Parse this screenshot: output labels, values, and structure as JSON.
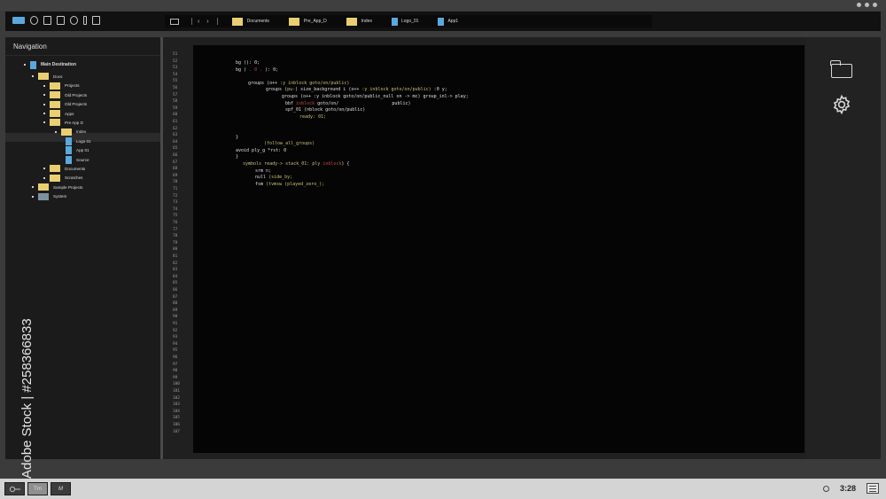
{
  "breadcrumbs": [
    {
      "label": "Documents",
      "kind": "folder"
    },
    {
      "label": "Pre_App_D",
      "kind": "folder"
    },
    {
      "label": "Index",
      "kind": "folder"
    },
    {
      "label": "Logo_01",
      "kind": "file"
    },
    {
      "label": "App1",
      "kind": "file"
    }
  ],
  "nav": {
    "title": "Navigation",
    "tree": [
      {
        "label": "Main Destination",
        "kind": "file",
        "level": 0,
        "bold": true
      },
      {
        "label": "Docs",
        "kind": "folder",
        "level": 1
      },
      {
        "label": "Projects",
        "kind": "folder",
        "level": 2
      },
      {
        "label": "Old Projects",
        "kind": "folder",
        "level": 2
      },
      {
        "label": "Old Projects",
        "kind": "folder",
        "level": 2
      },
      {
        "label": "Apps",
        "kind": "folder",
        "level": 2
      },
      {
        "label": "Pre App D",
        "kind": "folder",
        "level": 2
      },
      {
        "label": "Index",
        "kind": "folder",
        "level": 3,
        "selected": true
      },
      {
        "label": "Logo 01",
        "kind": "file",
        "level": 4
      },
      {
        "label": "App 01",
        "kind": "file",
        "level": 4
      },
      {
        "label": "Source",
        "kind": "file",
        "level": 4
      },
      {
        "label": "Documents",
        "kind": "folder",
        "level": 2
      },
      {
        "label": "Scratches",
        "kind": "folder",
        "level": 2
      },
      {
        "label": "Sample Projects",
        "kind": "folder",
        "level": 1
      },
      {
        "label": "System",
        "kind": "system",
        "level": 1
      }
    ]
  },
  "editor": {
    "first_line": 51,
    "last_line": 107,
    "lines": [
      {
        "indent": 48,
        "parts": [
          [
            "bg (): 0;",
            ""
          ]
        ]
      },
      {
        "indent": 48,
        "parts": [
          [
            "bg (",
            ""
          ],
          [
            " . 0 . ",
            "r"
          ],
          [
            "): 0;",
            ""
          ]
        ]
      },
      {
        "indent": 0,
        "parts": [
          [
            "",
            ""
          ]
        ]
      },
      {
        "indent": 62,
        "parts": [
          [
            "groups (o++ ",
            ""
          ],
          [
            ":y inblock goto/on/public)",
            "y"
          ]
        ]
      },
      {
        "indent": 82,
        "parts": [
          [
            "groups (",
            ""
          ],
          [
            "pu-",
            "y"
          ],
          [
            ") size_background i (o++ ",
            ""
          ],
          [
            ":y inblock goto/on/public)",
            "y"
          ],
          [
            " :0 y;",
            ""
          ]
        ]
      },
      {
        "indent": 100,
        "parts": [
          [
            "groups (o++ :y inblock goto/on/public_null on -> mc) group_inl-> play;",
            ""
          ]
        ]
      },
      {
        "indent": 104,
        "parts": [
          [
            "bbf ",
            ""
          ],
          [
            "inblock",
            "r"
          ],
          [
            " goto/on/                    public)",
            ""
          ]
        ]
      },
      {
        "indent": 104,
        "parts": [
          [
            "spf_01 (nblock goto/on/public)",
            ""
          ]
        ]
      },
      {
        "indent": 120,
        "parts": [
          [
            "ready: 01;",
            "y"
          ]
        ]
      },
      {
        "indent": 0,
        "parts": [
          [
            "",
            ""
          ]
        ]
      },
      {
        "indent": 0,
        "parts": [
          [
            "",
            ""
          ]
        ]
      },
      {
        "indent": 48,
        "parts": [
          [
            "}",
            ""
          ]
        ]
      },
      {
        "indent": 80,
        "parts": [
          [
            "(follow_all_groups)",
            "y"
          ]
        ]
      },
      {
        "indent": 48,
        "parts": [
          [
            "avoid ply_g *rst: 0",
            ""
          ]
        ]
      },
      {
        "indent": 48,
        "parts": [
          [
            "}",
            ""
          ]
        ]
      },
      {
        "indent": 56,
        "parts": [
          [
            "symbols ready-> stack_01: ply ",
            "y"
          ],
          [
            "inblock",
            "r"
          ],
          [
            ") {",
            ""
          ]
        ]
      },
      {
        "indent": 70,
        "parts": [
          [
            "srm n;",
            ""
          ]
        ]
      },
      {
        "indent": 70,
        "parts": [
          [
            "null ",
            ""
          ],
          [
            "(side_by;",
            "y"
          ]
        ]
      },
      {
        "indent": 70,
        "parts": [
          [
            "fsm ",
            ""
          ],
          [
            "(tvmsw (played_zero_);",
            "y"
          ]
        ]
      }
    ]
  },
  "bottom": {
    "buttons": [
      "",
      "Tm",
      "M"
    ],
    "time": "3:28"
  },
  "watermark": "Adobe Stock | #258366833",
  "colors": {
    "folder": "#e9cf72",
    "file": "#5aa9dc",
    "keyword_yellow": "#c9c17a",
    "keyword_red": "#c4473f"
  }
}
